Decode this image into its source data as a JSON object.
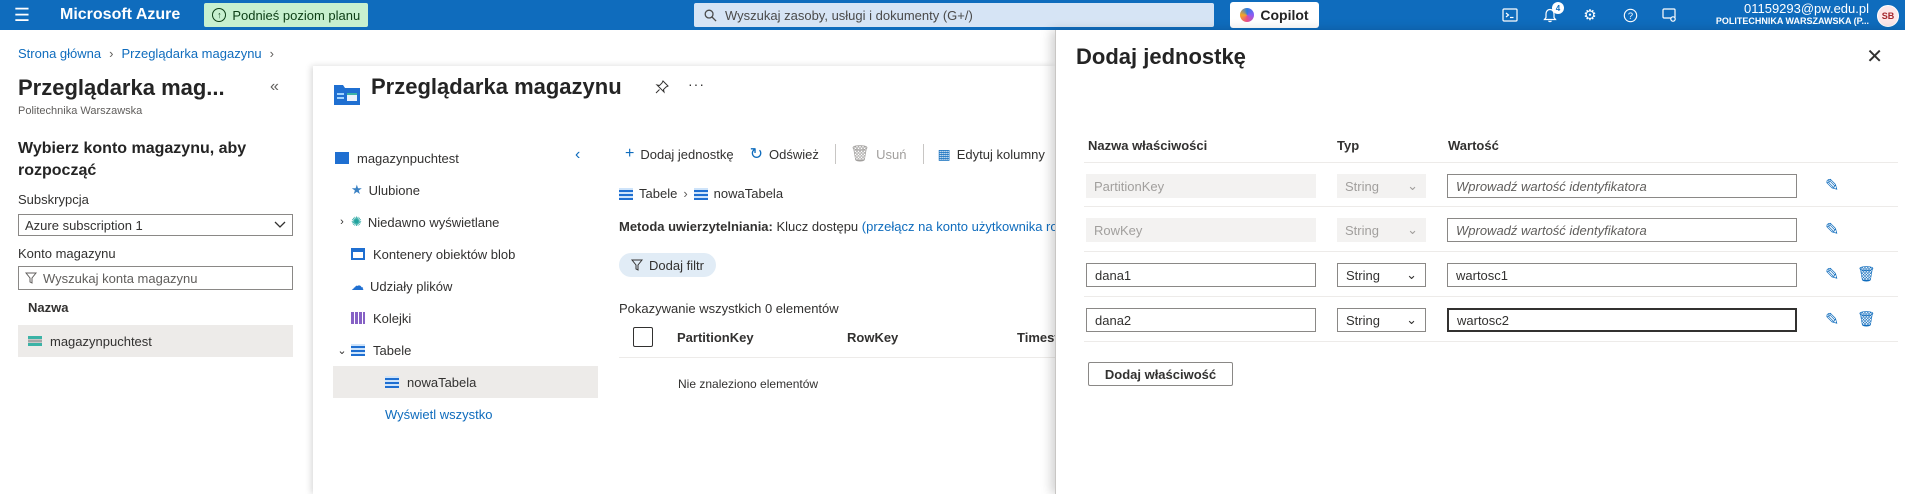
{
  "topbar": {
    "brand": "Microsoft Azure",
    "upgrade_label": "Podnieś poziom planu",
    "search_placeholder": "Wyszukaj zasoby, usługi i dokumenty (G+/)",
    "copilot_label": "Copilot",
    "notifications_count": "4",
    "account_email": "01159293@pw.edu.pl",
    "account_org": "POLITECHNIKA WARSZAWSKA (P...",
    "avatar_initials": "SB",
    "accent_color": "#0f6cbd"
  },
  "breadcrumb": {
    "items": [
      "Strona główna",
      "Przeglądarka magazynu"
    ]
  },
  "left_blade": {
    "title": "Przeglądarka mag...",
    "subtitle": "Politechnika Warszawska",
    "heading": "Wybierz konto magazynu, aby rozpocząć",
    "subscription_label": "Subskrypcja",
    "subscription_value": "Azure subscription 1",
    "account_label": "Konto magazynu",
    "account_search_placeholder": "Wyszukaj konta magazynu",
    "column_header": "Nazwa",
    "accounts": [
      "magazynpuchtest"
    ]
  },
  "main": {
    "title": "Przeglądarka magazynu",
    "tree": {
      "root": "magazynpuchtest",
      "items": [
        "Ulubione",
        "Niedawno wyświetlane",
        "Kontenery obiektów blob",
        "Udziały plików",
        "Kolejki",
        "Tabele"
      ],
      "child": "nowaTabela",
      "show_all": "Wyświetl wszystko"
    },
    "toolbar": {
      "add": "Dodaj jednostkę",
      "refresh": "Odśwież",
      "delete": "Usuń",
      "edit_columns": "Edytuj kolumny"
    },
    "table_breadcrumb": [
      "Tabele",
      "nowaTabela"
    ],
    "auth_label": "Metoda uwierzytelniania:",
    "auth_value": "Klucz dostępu",
    "auth_link": "(przełącz na konto użytkownika rozwiązania Microsoft Entra)",
    "filter_label": "Dodaj filtr",
    "showing_text": "Pokazywanie wszystkich 0 elementów",
    "columns": [
      "PartitionKey",
      "RowKey",
      "Timestamp"
    ],
    "empty_text": "Nie znaleziono elementów"
  },
  "panel": {
    "title": "Dodaj jednostkę",
    "headers": {
      "name": "Nazwa właściwości",
      "type": "Typ",
      "value": "Wartość"
    },
    "rows": [
      {
        "name": "PartitionKey",
        "type": "String",
        "value": "",
        "placeholder": "Wprowadź wartość identyfikatora"
      },
      {
        "name": "RowKey",
        "type": "String",
        "value": "",
        "placeholder": "Wprowadź wartość identyfikatora"
      },
      {
        "name": "dana1",
        "type": "String",
        "value": "wartosc1",
        "placeholder": ""
      },
      {
        "name": "dana2",
        "type": "String",
        "value": "wartosc2",
        "placeholder": ""
      }
    ],
    "add_property": "Dodaj właściwość"
  }
}
